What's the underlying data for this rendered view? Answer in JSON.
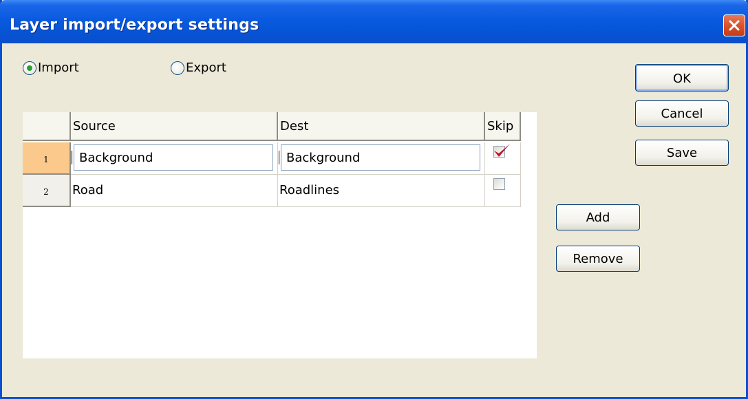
{
  "window": {
    "title": "Layer import/export settings"
  },
  "mode": {
    "options": [
      {
        "label": "Import",
        "checked": true
      },
      {
        "label": "Export",
        "checked": false
      }
    ]
  },
  "table": {
    "columns": [
      "",
      "Source",
      "Dest",
      "Skip"
    ],
    "rows": [
      {
        "num": "1",
        "source": "Background",
        "dest": "Background",
        "skip": true
      },
      {
        "num": "2",
        "source": "Road",
        "dest": "Roadlines",
        "skip": false
      }
    ]
  },
  "buttons": {
    "ok": "OK",
    "cancel": "Cancel",
    "save": "Save",
    "add": "Add",
    "remove": "Remove"
  },
  "colors": {
    "titlebar": "#0a5ae0",
    "close": "#d9532c",
    "selected_row_header": "#fcc98c",
    "checkmark": "#c2102a"
  }
}
